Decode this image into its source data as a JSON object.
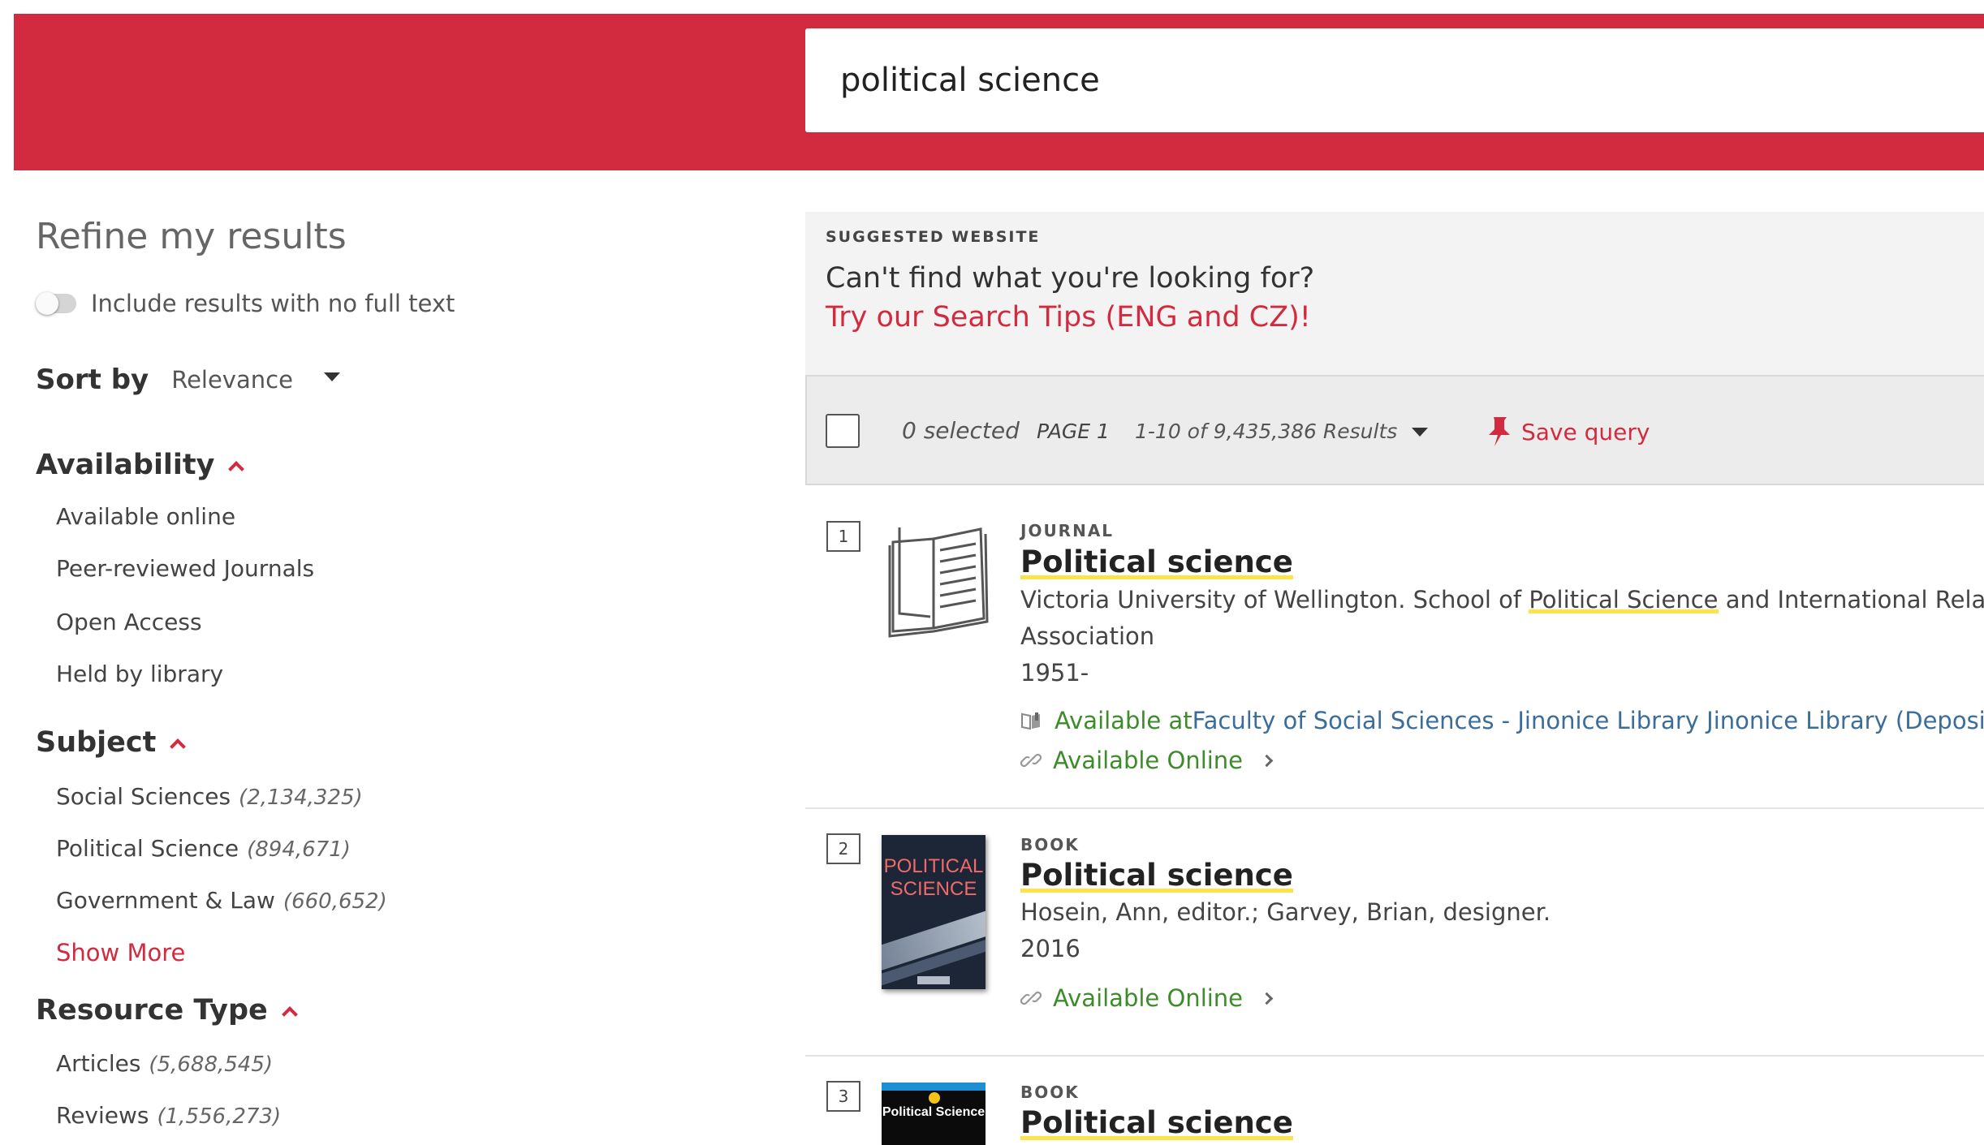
{
  "search": {
    "query": "political science"
  },
  "sidebar": {
    "title": "Refine my results",
    "toggle_label": "Include results with no full text",
    "sort_label": "Sort by",
    "sort_value": "Relevance",
    "facets": [
      {
        "heading": "Availability",
        "items": [
          {
            "label": "Available online",
            "count": ""
          },
          {
            "label": "Peer-reviewed Journals",
            "count": ""
          },
          {
            "label": "Open Access",
            "count": ""
          },
          {
            "label": "Held by library",
            "count": ""
          }
        ]
      },
      {
        "heading": "Subject",
        "items": [
          {
            "label": "Social Sciences",
            "count": "(2,134,325)"
          },
          {
            "label": "Political Science",
            "count": "(894,671)"
          },
          {
            "label": "Government & Law",
            "count": "(660,652)"
          }
        ],
        "show_more": "Show More"
      },
      {
        "heading": "Resource Type",
        "items": [
          {
            "label": "Articles",
            "count": "(5,688,545)"
          },
          {
            "label": "Reviews",
            "count": "(1,556,273)"
          }
        ]
      }
    ]
  },
  "suggestion": {
    "tag": "SUGGESTED WEBSITE",
    "line1": "Can't find what you're looking for?",
    "link": "Try our Search Tips (ENG and CZ)!"
  },
  "toolbar": {
    "selected": "0 selected",
    "page": "PAGE 1",
    "range": "1-10 of 9,435,386 Results",
    "save": "Save query"
  },
  "results": [
    {
      "num": "1",
      "type": "JOURNAL",
      "title": "Political science",
      "author_pre": "Victoria University of Wellington. School of ",
      "author_hl": "Political Science",
      "author_post": " and International Relations; N",
      "author_line2": "Association",
      "date": "1951-",
      "avail_loc_green": "Available at ",
      "avail_loc_blue": "Faculty of Social Sciences - Jinonice Library  Jinonice Library (Depositor",
      "avail_online": "Available Online"
    },
    {
      "num": "2",
      "type": "BOOK",
      "title": "Political science",
      "cover_text": "POLITICAL SCIENCE",
      "author": "Hosein, Ann, editor.; Garvey, Brian, designer.",
      "date": "2016",
      "avail_online": "Available Online"
    },
    {
      "num": "3",
      "type": "BOOK",
      "title": "Political science",
      "cover_text": "Political Science"
    }
  ],
  "colors": {
    "brand_red": "#d22b40",
    "available_green": "#3d8b2b",
    "highlight_yellow": "#fde34a"
  }
}
